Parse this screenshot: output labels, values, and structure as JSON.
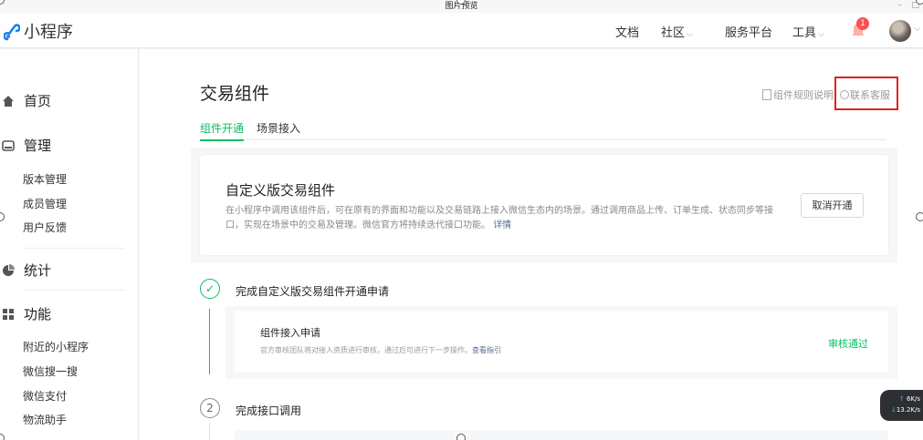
{
  "window": {
    "title": "图片预览",
    "controls": [
      "–",
      "□"
    ]
  },
  "topnav": {
    "brand": "小程序",
    "links": [
      {
        "label": "文档"
      },
      {
        "label": "社区",
        "caret": "⌵"
      },
      {
        "label": "服务平台"
      },
      {
        "label": "工具",
        "caret": "⌵"
      }
    ],
    "notification_count": "1",
    "avatar_caret": "⌵"
  },
  "sidebar": {
    "sections": [
      {
        "label": "首页",
        "icon": "home-icon"
      },
      {
        "label": "管理",
        "icon": "manage-icon",
        "items": [
          "版本管理",
          "成员管理",
          "用户反馈"
        ]
      },
      {
        "label": "统计",
        "icon": "stats-icon"
      },
      {
        "label": "功能",
        "icon": "feature-icon",
        "items": [
          "附近的小程序",
          "微信搜一搜",
          "微信支付",
          "物流助手"
        ]
      }
    ]
  },
  "main": {
    "title": "交易组件",
    "rule_link": "组件规则说明",
    "contact_link": "联系客服",
    "tabs": [
      "组件开通",
      "场景接入"
    ],
    "card": {
      "title": "自定义版交易组件",
      "desc": "在小程序中调用该组件后，可在原有的界面和功能以及交易链路上接入微信生态内的场景。通过调用商品上传、订单生成、状态同步等接口，实现在场景中的交易及管理。微信官方将持续迭代接口功能。",
      "detail_link": "详情",
      "cancel_button": "取消开通"
    },
    "steps": [
      {
        "index": "✓",
        "title": "完成自定义版交易组件开通申请",
        "sub": {
          "title": "组件接入申请",
          "desc": "官方审核团队将对接入资质进行审核，通过后可进行下一步操作。",
          "guide_link": "查看指引",
          "status": "审核通过"
        }
      },
      {
        "index": "2",
        "title": "完成接口调用"
      }
    ]
  },
  "net_widget": {
    "up": "6K/s",
    "down": "13.2K/s"
  },
  "colors": {
    "accent": "#07c160",
    "link": "#576b95",
    "highlight": "#e02020",
    "badge": "#fa5151"
  }
}
